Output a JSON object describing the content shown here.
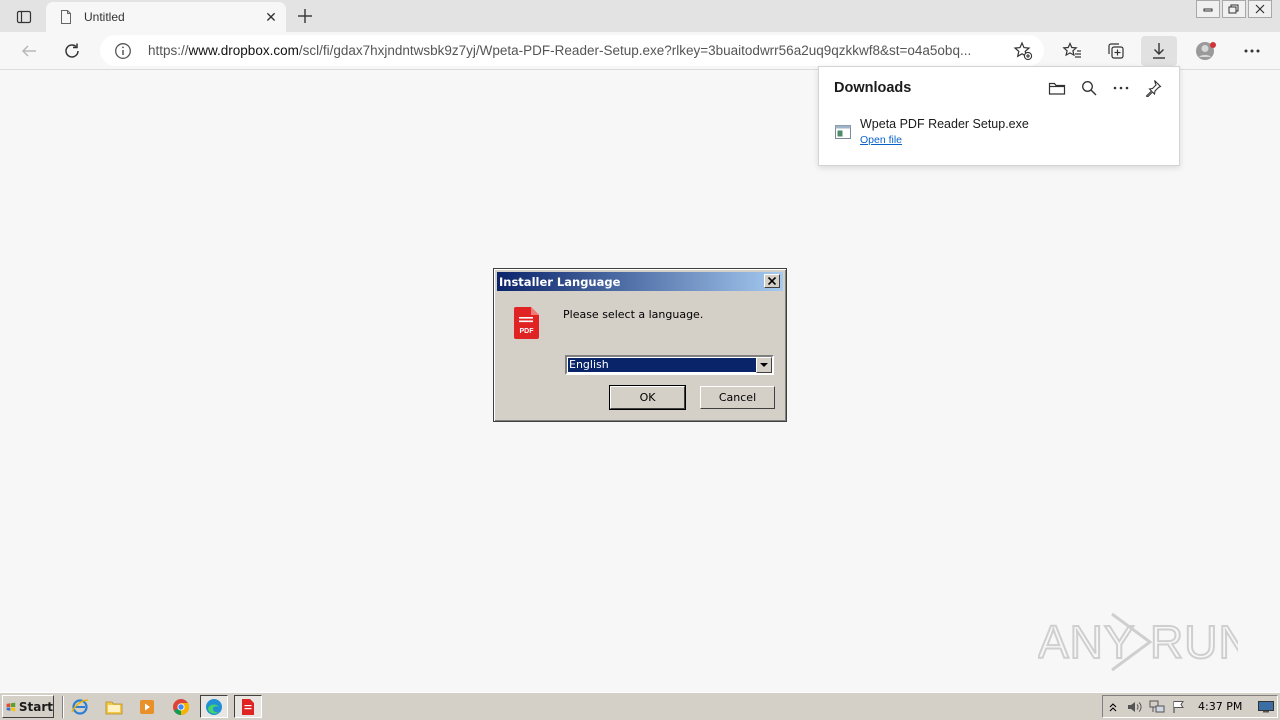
{
  "browser": {
    "tab_title": "Untitled",
    "url_prefix": "https://",
    "url_domain": "www.dropbox.com",
    "url_path": "/scl/fi/gdax7hxjndntwsbk9z7yj/Wpeta-PDF-Reader-Setup.exe?rlkey=3buaitodwrr56a2uq9qzkkwf8&st=o4a5obq..."
  },
  "downloads": {
    "title": "Downloads",
    "items": [
      {
        "file_name": "Wpeta PDF Reader Setup.exe",
        "action": "Open file"
      }
    ]
  },
  "dialog": {
    "title": "Installer Language",
    "message": "Please select a language.",
    "selected_language": "English",
    "ok_label": "OK",
    "cancel_label": "Cancel"
  },
  "watermark": {
    "text": "ANY RUN"
  },
  "taskbar": {
    "start_label": "Start",
    "clock": "4:37 PM"
  },
  "colors": {
    "title_gradient_start": "#0a246a",
    "title_gradient_end": "#a6caf0",
    "link": "#0a62c9",
    "pdf_red": "#e02424"
  }
}
